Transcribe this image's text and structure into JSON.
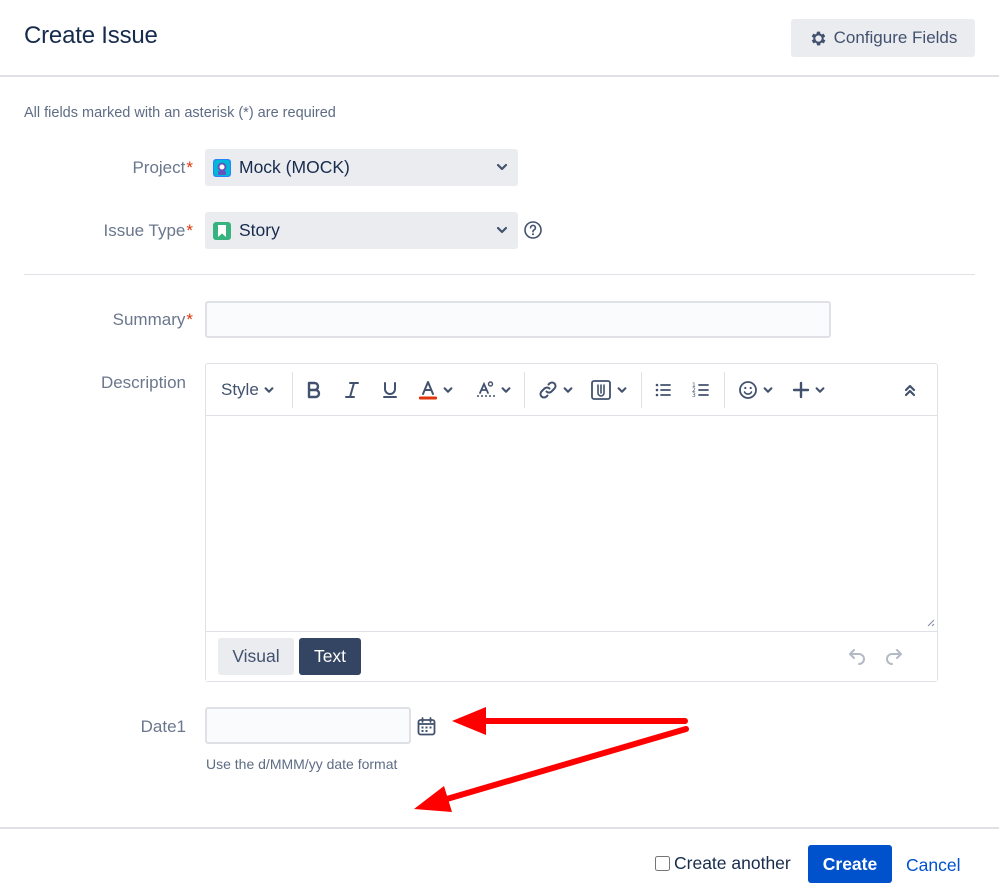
{
  "dialog": {
    "title": "Create Issue",
    "configure_fields_label": "Configure Fields",
    "required_note": "All fields marked with an asterisk (*) are required"
  },
  "fields": {
    "project": {
      "label": "Project",
      "required_mark": "*",
      "value": "Mock (MOCK)",
      "icon": "project-avatar-icon"
    },
    "issue_type": {
      "label": "Issue Type",
      "required_mark": "*",
      "value": "Story",
      "icon": "story-icon"
    },
    "summary": {
      "label": "Summary",
      "required_mark": "*",
      "value": ""
    },
    "description": {
      "label": "Description",
      "value": ""
    },
    "date1": {
      "label": "Date1",
      "value": "",
      "hint": "Use the d/MMM/yy date format"
    }
  },
  "editor": {
    "style_label": "Style",
    "toolbar_icons": [
      "bold-icon",
      "italic-icon",
      "underline-icon",
      "text-color-icon",
      "text-effects-icon",
      "link-icon",
      "attachment-icon",
      "bullet-list-icon",
      "numbered-list-icon",
      "emoji-icon",
      "insert-more-icon",
      "collapse-toolbar-icon"
    ],
    "modes": {
      "visual": "Visual",
      "text": "Text"
    },
    "active_mode": "Text"
  },
  "footer": {
    "create_another_label": "Create another",
    "create_another_checked": false,
    "create_label": "Create",
    "cancel_label": "Cancel"
  },
  "colors": {
    "primary": "#0052cc",
    "text_dark": "#172b4d",
    "label_gray": "#6b778c",
    "required_red": "#de350b",
    "annotation_arrow": "#ff0000",
    "text_mode_active": "#344563"
  }
}
